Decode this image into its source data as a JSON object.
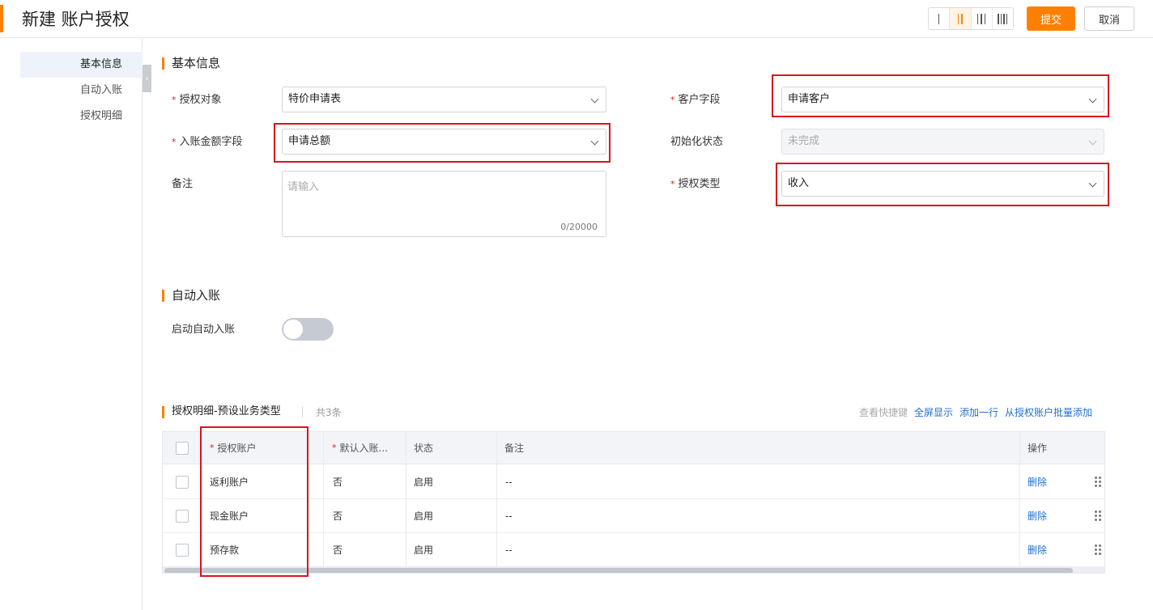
{
  "header": {
    "title": "新建 账户授权",
    "submit_label": "提交",
    "cancel_label": "取消",
    "column_layouts": [
      "1",
      "2",
      "3",
      "4"
    ],
    "column_layout_selected": "2",
    "accent_color": "#ff8000"
  },
  "nav": {
    "items": [
      {
        "label": "基本信息",
        "active": true
      },
      {
        "label": "自动入账",
        "active": false
      },
      {
        "label": "授权明细",
        "active": false
      }
    ]
  },
  "basic": {
    "section_title": "基本信息",
    "auth_object": {
      "label": "授权对象",
      "value": "特价申请表",
      "required": true
    },
    "amount_field": {
      "label": "入账金额字段",
      "value": "申请总额",
      "required": true
    },
    "remark": {
      "label": "备注",
      "placeholder": "请输入",
      "counter": "0/20000"
    },
    "customer_field": {
      "label": "客户字段",
      "value": "申请客户",
      "required": true
    },
    "init_status": {
      "label": "初始化状态",
      "value": "未完成",
      "disabled": true
    },
    "auth_type": {
      "label": "授权类型",
      "value": "收入",
      "required": true
    }
  },
  "auto": {
    "section_title": "自动入账",
    "toggle_label": "启动自动入账",
    "enabled": false
  },
  "detail": {
    "section_title": "授权明细-预设业务类型",
    "count_text": "共3条",
    "shortcut_label": "查看快捷键",
    "fullscreen_label": "全屏显示",
    "add_row_label": "添加一行",
    "batch_add_label": "从授权账户批量添加",
    "columns": {
      "account": "授权账户",
      "default": "默认入账...",
      "status": "状态",
      "remark": "备注",
      "action": "操作"
    },
    "rows": [
      {
        "account": "返利账户",
        "default": "否",
        "status": "启用",
        "remark": "--",
        "action": "删除"
      },
      {
        "account": "现金账户",
        "default": "否",
        "status": "启用",
        "remark": "--",
        "action": "删除"
      },
      {
        "account": "预存款",
        "default": "否",
        "status": "启用",
        "remark": "--",
        "action": "删除"
      }
    ]
  }
}
